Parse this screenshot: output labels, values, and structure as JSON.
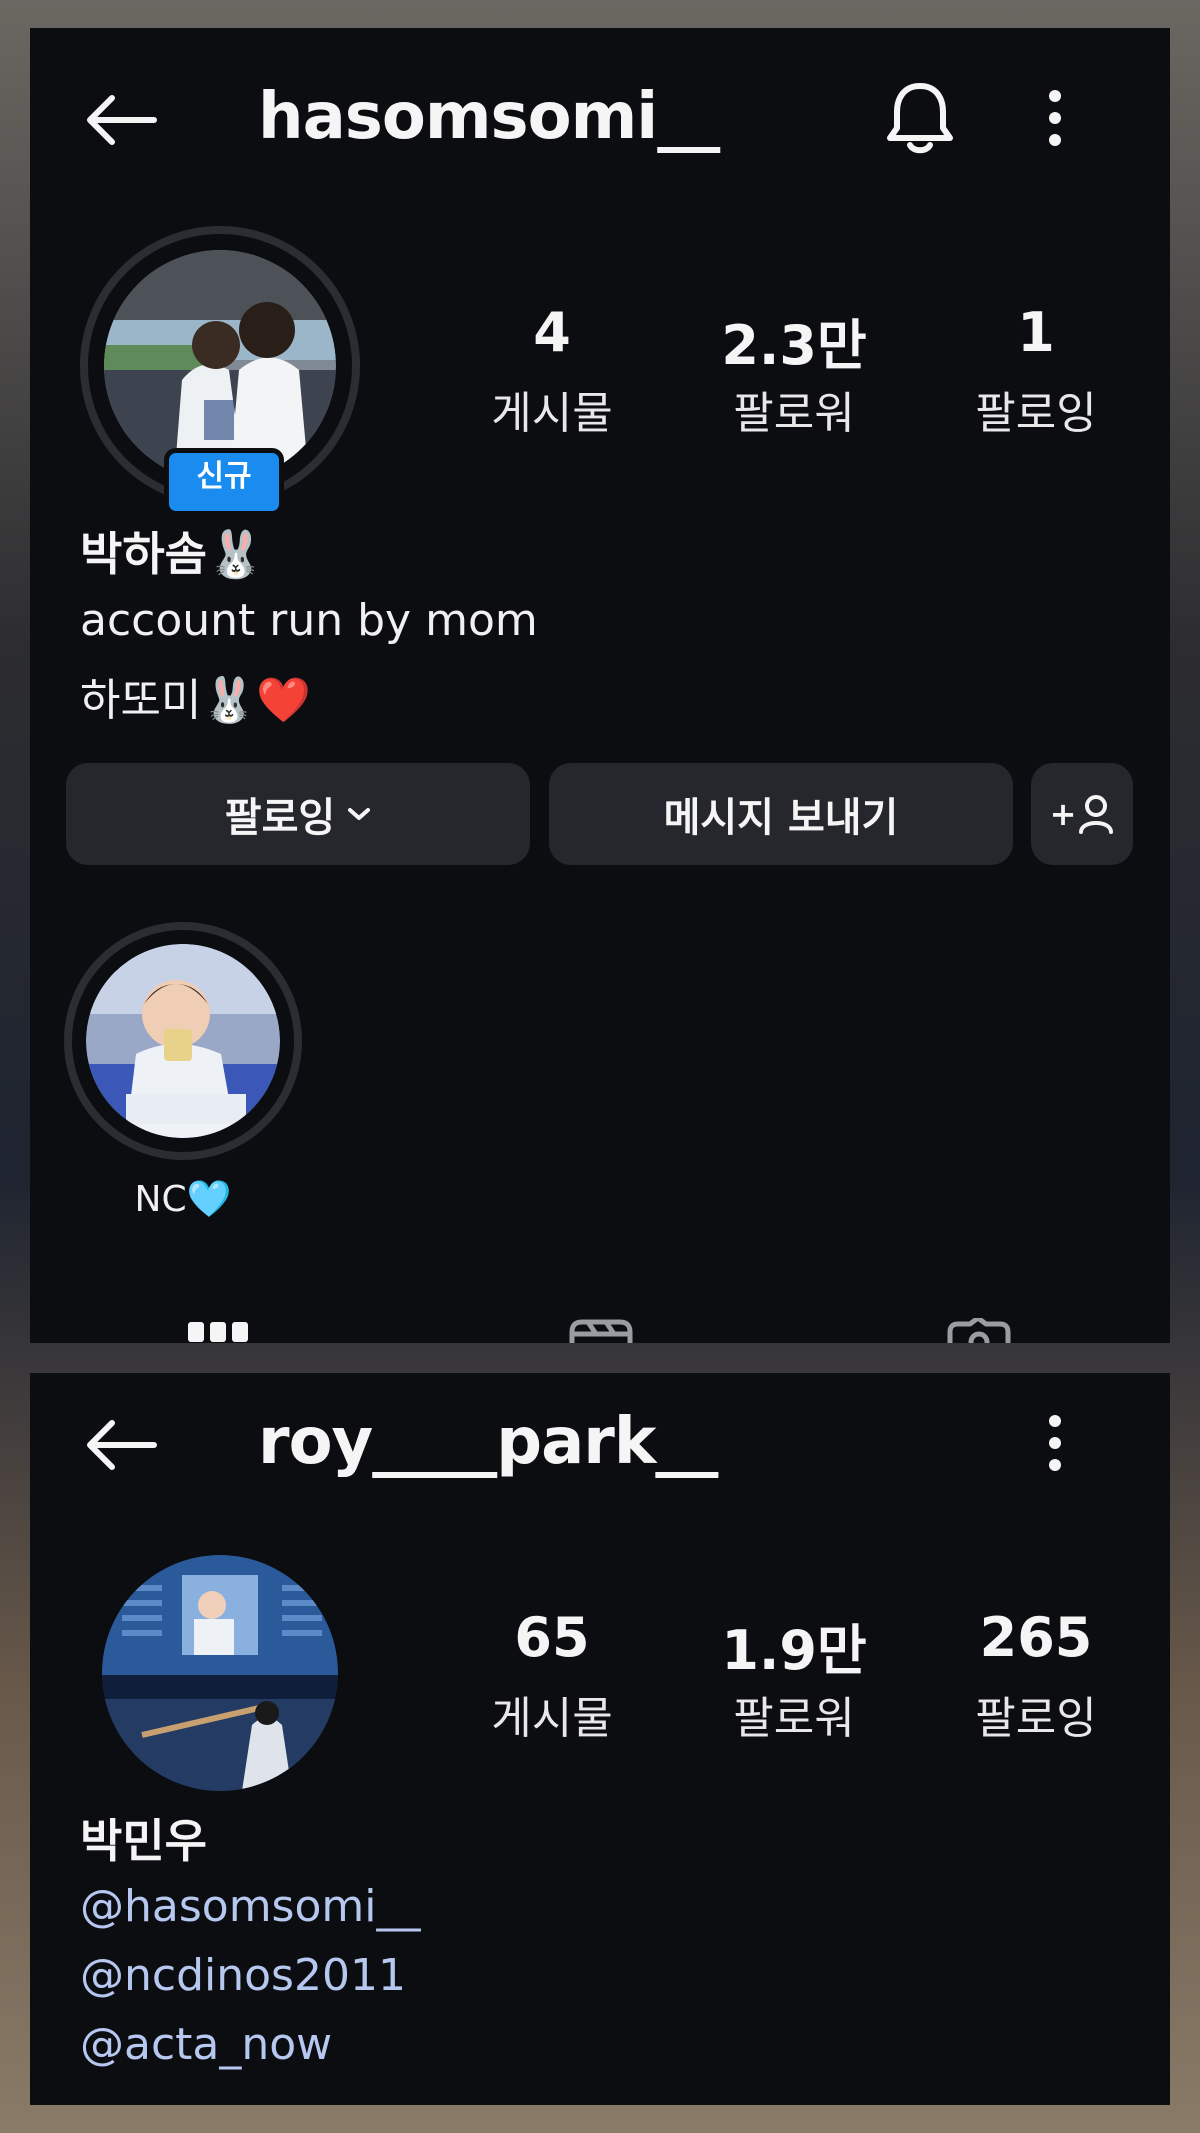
{
  "top_profile": {
    "username": "hasomsomi__",
    "stats": [
      {
        "value": "4",
        "label": "게시물"
      },
      {
        "value": "2.3만",
        "label": "팔로워"
      },
      {
        "value": "1",
        "label": "팔로잉"
      }
    ],
    "new_badge": "신규",
    "full_name": "박하솜🐰",
    "bio": [
      "account run by mom",
      "하또미🐰❤️"
    ],
    "buttons": {
      "following": "팔로잉",
      "message": "메시지 보내기",
      "add_user": "+"
    },
    "highlight": {
      "label": "NC🩵"
    }
  },
  "bottom_profile": {
    "username": "roy____park__",
    "stats": [
      {
        "value": "65",
        "label": "게시물"
      },
      {
        "value": "1.9만",
        "label": "팔로워"
      },
      {
        "value": "265",
        "label": "팔로잉"
      }
    ],
    "full_name": "박민우",
    "links": [
      "@hasomsomi__",
      "@ncdinos2011",
      "@acta_now"
    ]
  },
  "colors": {
    "background": "#0c0d11",
    "button": "#25272c",
    "badge": "#1a8cf0",
    "link": "#b6c8ef",
    "text": "#f5f5f5"
  },
  "icons": [
    "back-arrow-icon",
    "bell-icon",
    "more-vertical-icon",
    "chevron-down-icon",
    "add-person-icon",
    "grid-icon",
    "reels-icon",
    "tagged-icon"
  ]
}
